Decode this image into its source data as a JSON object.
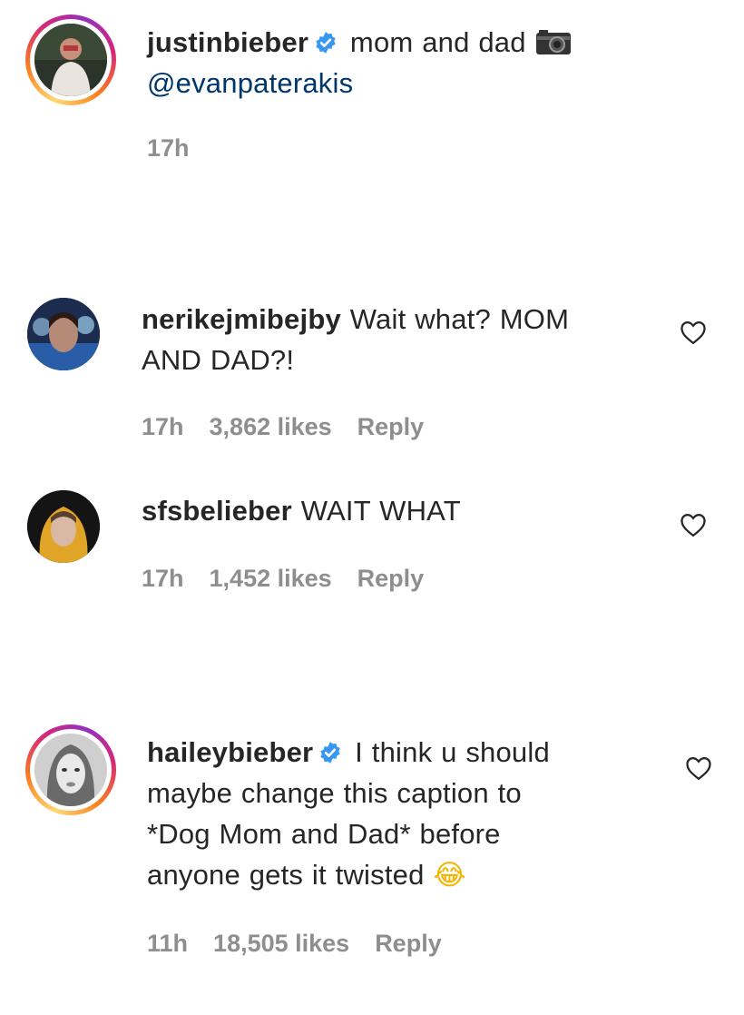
{
  "post": {
    "username": "justinbieber",
    "caption": "mom and dad",
    "caption_icon": "camera-icon",
    "mention": "@evanpaterakis",
    "time": "17h"
  },
  "comments": [
    {
      "username": "nerikejmibejby",
      "text_line1": "Wait what? MOM",
      "text_line2": "AND DAD?!",
      "time": "17h",
      "likes": "3,862 likes",
      "reply": "Reply"
    },
    {
      "username": "sfsbelieber",
      "text_line1": "WAIT WHAT",
      "time": "17h",
      "likes": "1,452 likes",
      "reply": "Reply"
    },
    {
      "username": "haileybieber",
      "text_line1": "I think u should",
      "text_line2": "maybe change this caption to",
      "text_line3": "*Dog Mom and Dad* before",
      "text_line4": "anyone gets it twisted",
      "emoji": "😂",
      "time": "11h",
      "likes": "18,505 likes",
      "reply": "Reply"
    }
  ],
  "colors": {
    "verified": "#3897f0",
    "meta": "#8e8e8e",
    "mention": "#00376b"
  }
}
